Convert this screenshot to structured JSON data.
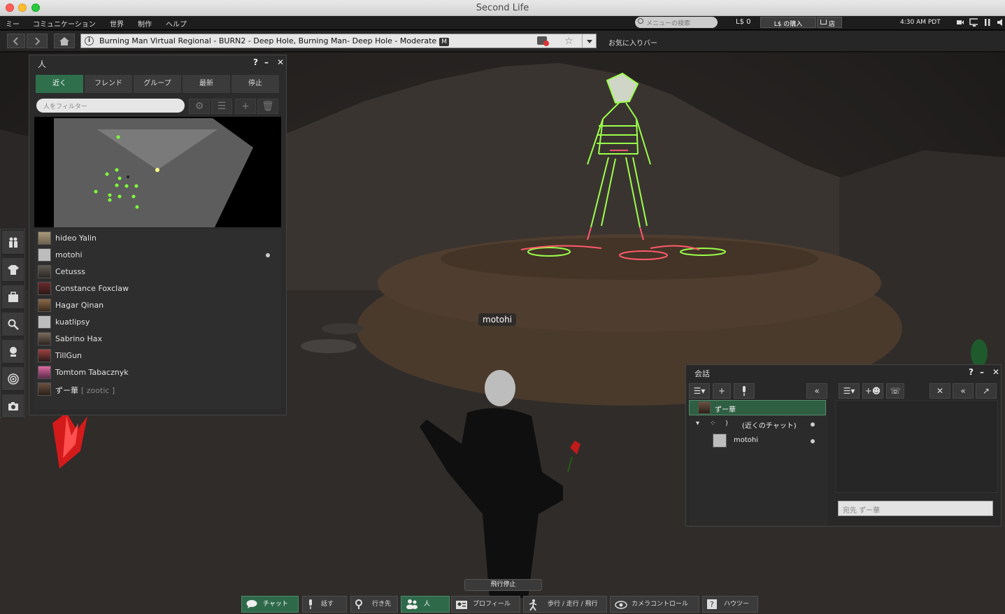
{
  "window": {
    "title": "Second Life"
  },
  "menubar": {
    "items": [
      "ミー",
      "コミュニケーション",
      "世界",
      "制作",
      "ヘルプ"
    ],
    "search_placeholder": "メニューの検索",
    "balance": "L$ 0",
    "buy_label": "L$ の購入",
    "shop_label": "店",
    "clock": "4:30 AM PDT"
  },
  "navbar": {
    "location": "Burning Man Virtual Regional - BURN2 - Deep Hole, Burning Man- Deep Hole - Moderate",
    "maturity_badge": "M",
    "favorites_label": "お気に入りバー"
  },
  "people": {
    "title": "人",
    "tabs": [
      "近く",
      "フレンド",
      "グループ",
      "最新",
      "停止"
    ],
    "filter_placeholder": "人をフィルター",
    "list": [
      {
        "name": "hideo Yalin",
        "sub": ""
      },
      {
        "name": "motohi",
        "sub": ""
      },
      {
        "name": "Cetusss",
        "sub": ""
      },
      {
        "name": "Constance Foxclaw",
        "sub": ""
      },
      {
        "name": "Hagar Qinan",
        "sub": ""
      },
      {
        "name": "kuatlipsy",
        "sub": ""
      },
      {
        "name": "Sabrino Hax",
        "sub": ""
      },
      {
        "name": "TillGun",
        "sub": ""
      },
      {
        "name": "Tomtom Tabacznyk",
        "sub": ""
      },
      {
        "name": "ずー華",
        "sub": "[ zootic ]"
      }
    ]
  },
  "scene": {
    "nametag": "motohi"
  },
  "conversations": {
    "title": "会話",
    "items": [
      {
        "label": "ずー華"
      },
      {
        "label": "(近くのチャット)"
      },
      {
        "label": "motohi"
      }
    ],
    "to_placeholder": "宛先 ずー華"
  },
  "stop_flying": "飛行停止",
  "bottombar": {
    "buttons": [
      "チャット",
      "話す",
      "行き先",
      "人",
      "プロフィール",
      "歩行 / 走行 / 飛行",
      "カメラコントロール",
      "ハウツー"
    ]
  },
  "colors": {
    "accent_green": "#2f6f4c",
    "effigy_green": "#9aff4a",
    "effigy_red": "#ff5a6a"
  }
}
